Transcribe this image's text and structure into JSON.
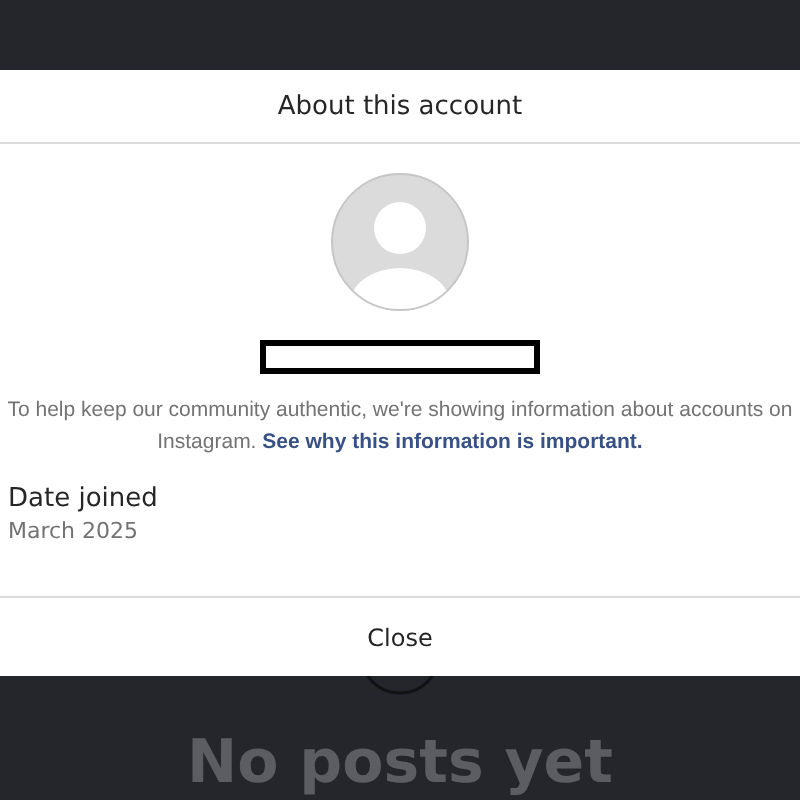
{
  "dialog": {
    "title": "About this account",
    "notice": "To help keep our community authentic, we're showing information about accounts on Instagram. ",
    "notice_link": "See why this information is important.",
    "details": [
      {
        "label": "Date joined",
        "value": "March 2025"
      }
    ],
    "close_button": "Close"
  },
  "background": {
    "empty_state": "No posts yet"
  }
}
